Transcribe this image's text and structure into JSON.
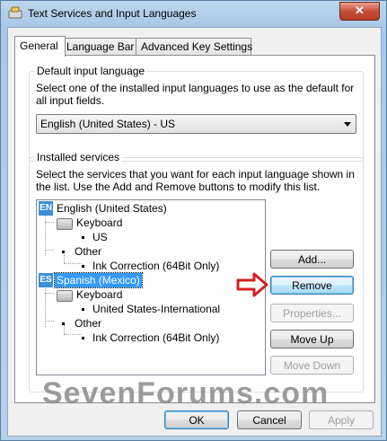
{
  "window": {
    "title": "Text Services and Input Languages",
    "close_label": "✕"
  },
  "tabs": [
    {
      "label": "General"
    },
    {
      "label": "Language Bar"
    },
    {
      "label": "Advanced Key Settings"
    }
  ],
  "default_group": {
    "label": "Default input language",
    "description": "Select one of the installed input languages to use as the default for all input fields.",
    "selected": "English (United States) - US"
  },
  "installed_group": {
    "label": "Installed services",
    "description": "Select the services that you want for each input language shown in the list. Use the Add and Remove buttons to modify this list."
  },
  "tree": {
    "english": {
      "badge": "EN",
      "label": "English (United States)",
      "keyboard": "Keyboard",
      "keyboard_item": "US",
      "other": "Other",
      "other_item": "Ink Correction (64Bit Only)"
    },
    "spanish": {
      "badge": "ES",
      "label": "Spanish (Mexico)",
      "keyboard": "Keyboard",
      "keyboard_item": "United States-International",
      "other": "Other",
      "other_item": "Ink Correction (64Bit Only)"
    }
  },
  "side_buttons": {
    "add": "Add...",
    "remove": "Remove",
    "properties": "Properties...",
    "move_up": "Move Up",
    "move_down": "Move Down"
  },
  "footer_buttons": {
    "ok": "OK",
    "cancel": "Cancel",
    "apply": "Apply"
  },
  "watermark": "SevenForums.com",
  "colors": {
    "selection": "#3399ff",
    "annotation_arrow": "#d42020",
    "language_icon": "#3a8fd8"
  }
}
